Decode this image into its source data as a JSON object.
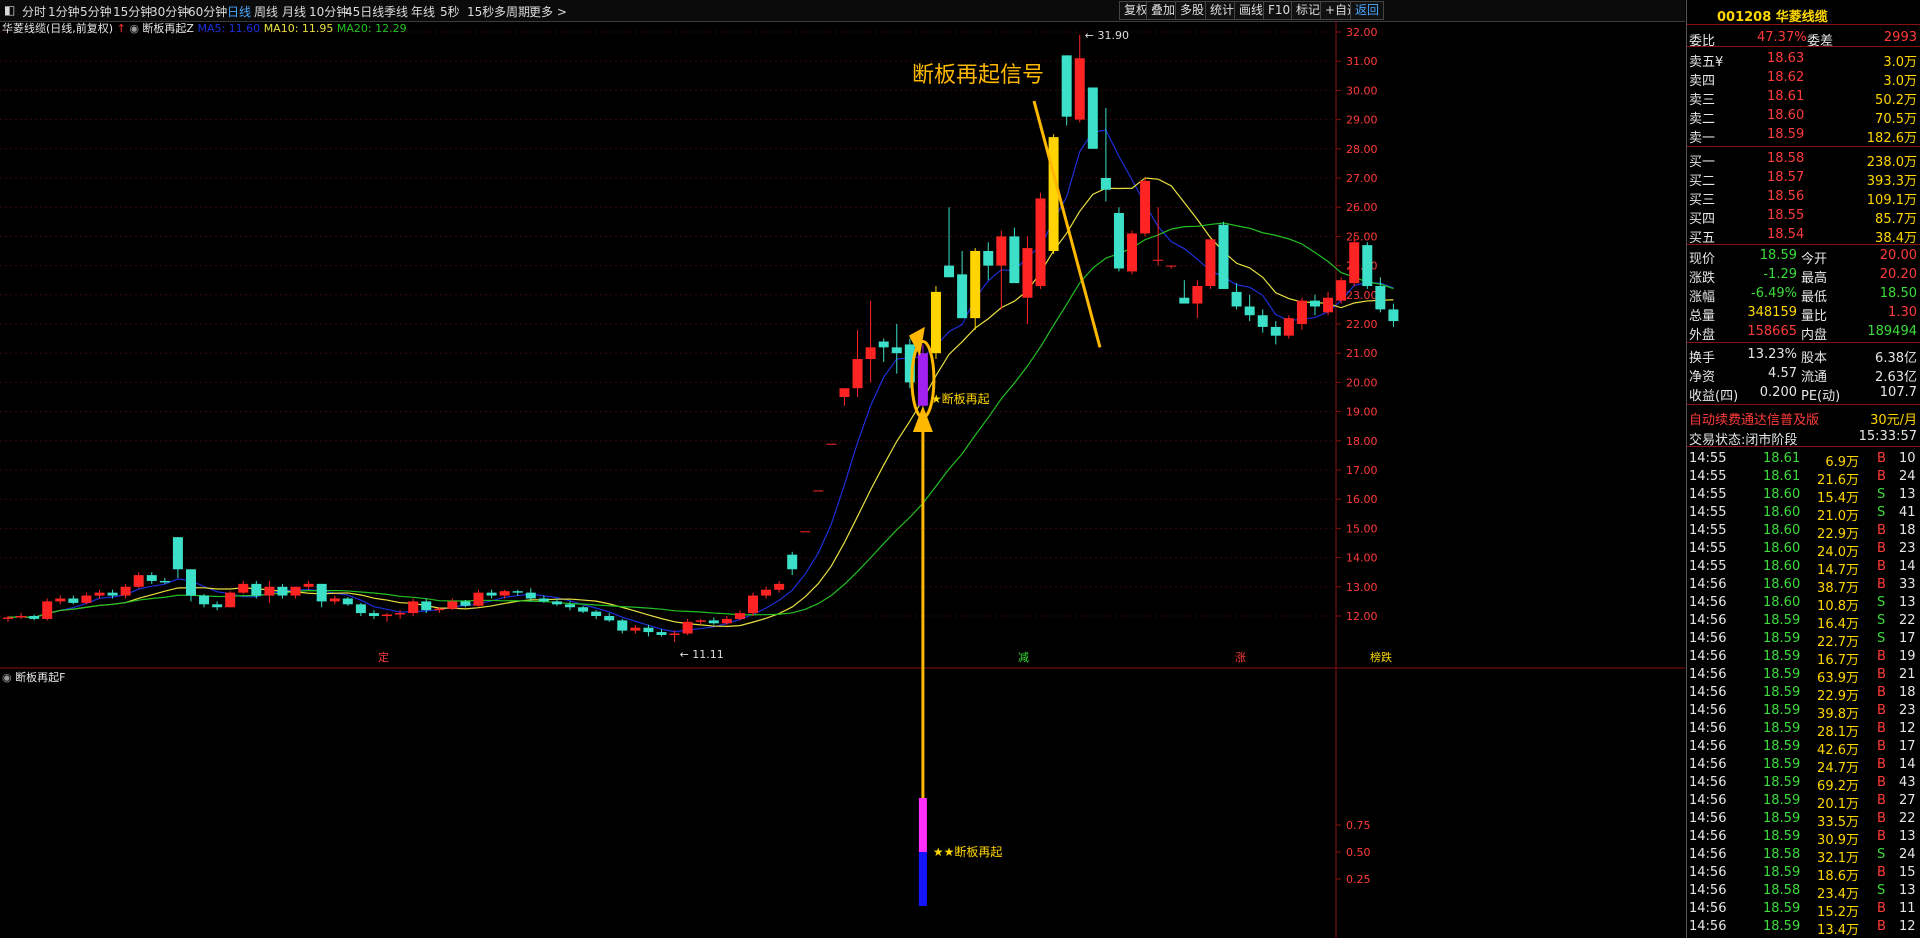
{
  "toolbar": {
    "periods": [
      "分时",
      "1分钟",
      "5分钟",
      "15分钟",
      "30分钟",
      "60分钟",
      "日线",
      "周线",
      "月线",
      "10分钟",
      "45日线",
      "季线",
      "年线",
      "5秒",
      "15秒",
      "多周期",
      "更多 >"
    ],
    "active": "日线",
    "right_buttons": [
      "复权",
      "叠加",
      "多股",
      "统计",
      "画线",
      "F10",
      "标记",
      "+自选",
      "返回"
    ],
    "selected_button": "返回"
  },
  "chart": {
    "stock_label": "华菱线缆(日线,前复权)",
    "indicator_name": "断板再起Z",
    "ma5": "MA5: 11.60",
    "ma10": "MA10: 11.95",
    "ma20": "MA20: 12.29",
    "high_label": "31.90",
    "low_label": "11.11",
    "annotation": "断板再起信号",
    "signal_label": "断板再起",
    "bottom_tags": [
      "定",
      "减",
      "涨",
      "榜跌"
    ],
    "yaxis": [
      "32.00",
      "31.00",
      "30.00",
      "29.00",
      "28.00",
      "27.00",
      "26.00",
      "25.00",
      "24.00",
      "23.00",
      "22.00",
      "21.00",
      "20.00",
      "19.00",
      "18.00",
      "17.00",
      "16.00",
      "15.00",
      "14.00",
      "13.00",
      "12.00"
    ],
    "sub_title": "断板再起F",
    "sub_yaxis": [
      "0.75",
      "0.50",
      "0.25"
    ],
    "sub_signal": "★断板再起",
    "colors": {
      "up": "#ff2424",
      "down": "#3ce0c8",
      "ma5": "#1d2fd8",
      "ma10": "#e8e040",
      "ma20": "#22c022",
      "signal": "#ffb800"
    }
  },
  "chart_data": {
    "type": "candlestick",
    "ylim": [
      11,
      32.2
    ],
    "candles": [
      [
        11.9,
        12.0,
        11.8,
        11.95
      ],
      [
        11.95,
        12.1,
        11.9,
        12.0
      ],
      [
        12.0,
        12.05,
        11.85,
        11.9
      ],
      [
        11.9,
        12.6,
        11.85,
        12.5
      ],
      [
        12.5,
        12.7,
        12.4,
        12.6
      ],
      [
        12.6,
        12.7,
        12.4,
        12.45
      ],
      [
        12.45,
        12.8,
        12.4,
        12.7
      ],
      [
        12.7,
        12.9,
        12.6,
        12.8
      ],
      [
        12.8,
        12.9,
        12.6,
        12.7
      ],
      [
        12.7,
        13.1,
        12.6,
        13.0
      ],
      [
        13.0,
        13.5,
        12.95,
        13.4
      ],
      [
        13.4,
        13.5,
        13.1,
        13.2
      ],
      [
        13.2,
        13.3,
        13.1,
        13.15
      ],
      [
        14.7,
        14.7,
        13.3,
        13.6
      ],
      [
        13.6,
        13.6,
        12.5,
        12.7
      ],
      [
        12.7,
        12.75,
        12.3,
        12.4
      ],
      [
        12.4,
        12.5,
        12.2,
        12.3
      ],
      [
        12.3,
        12.85,
        12.3,
        12.8
      ],
      [
        12.8,
        13.2,
        12.75,
        13.1
      ],
      [
        13.1,
        13.2,
        12.6,
        12.7
      ],
      [
        12.7,
        13.2,
        12.45,
        13.0
      ],
      [
        13.0,
        13.1,
        12.6,
        12.7
      ],
      [
        12.7,
        13.0,
        12.6,
        13.0
      ],
      [
        13.0,
        13.2,
        12.9,
        13.1
      ],
      [
        13.1,
        13.1,
        12.3,
        12.5
      ],
      [
        12.5,
        12.7,
        12.4,
        12.6
      ],
      [
        12.6,
        12.65,
        12.35,
        12.4
      ],
      [
        12.4,
        12.45,
        12.0,
        12.1
      ],
      [
        12.1,
        12.2,
        11.9,
        12.0
      ],
      [
        12.0,
        12.1,
        11.8,
        12.05
      ],
      [
        12.05,
        12.2,
        11.9,
        12.1
      ],
      [
        12.1,
        12.6,
        12.0,
        12.5
      ],
      [
        12.5,
        12.6,
        12.1,
        12.2
      ],
      [
        12.2,
        12.3,
        12.1,
        12.25
      ],
      [
        12.25,
        12.6,
        12.2,
        12.5
      ],
      [
        12.5,
        12.55,
        12.3,
        12.35
      ],
      [
        12.35,
        12.9,
        12.3,
        12.8
      ],
      [
        12.8,
        12.9,
        12.6,
        12.7
      ],
      [
        12.7,
        12.9,
        12.6,
        12.85
      ],
      [
        12.85,
        12.9,
        12.7,
        12.8
      ],
      [
        12.8,
        12.95,
        12.5,
        12.6
      ],
      [
        12.6,
        12.7,
        12.45,
        12.5
      ],
      [
        12.5,
        12.6,
        12.35,
        12.4
      ],
      [
        12.4,
        12.5,
        12.2,
        12.3
      ],
      [
        12.3,
        12.35,
        12.1,
        12.15
      ],
      [
        12.15,
        12.2,
        11.9,
        12.0
      ],
      [
        12.0,
        12.1,
        11.8,
        11.85
      ],
      [
        11.85,
        11.9,
        11.4,
        11.5
      ],
      [
        11.5,
        11.7,
        11.4,
        11.6
      ],
      [
        11.6,
        11.7,
        11.3,
        11.45
      ],
      [
        11.45,
        11.55,
        11.3,
        11.35
      ],
      [
        11.35,
        11.5,
        11.11,
        11.4
      ],
      [
        11.4,
        11.9,
        11.35,
        11.8
      ],
      [
        11.8,
        11.9,
        11.7,
        11.85
      ],
      [
        11.85,
        11.95,
        11.7,
        11.75
      ],
      [
        11.75,
        12.0,
        11.7,
        11.9
      ],
      [
        11.9,
        12.2,
        11.85,
        12.1
      ],
      [
        12.1,
        12.8,
        12.0,
        12.7
      ],
      [
        12.7,
        13.0,
        12.6,
        12.9
      ],
      [
        12.9,
        13.2,
        12.8,
        13.1
      ],
      [
        14.1,
        14.2,
        13.4,
        13.6
      ],
      [
        14.9,
        14.9,
        14.9,
        14.9
      ],
      [
        16.3,
        16.3,
        16.3,
        16.3
      ],
      [
        17.9,
        17.9,
        17.9,
        17.9
      ],
      [
        19.5,
        19.7,
        19.2,
        19.8
      ],
      [
        19.8,
        21.8,
        19.5,
        20.8
      ],
      [
        20.8,
        22.8,
        20.0,
        21.2
      ],
      [
        21.4,
        21.5,
        20.7,
        21.2
      ],
      [
        21.2,
        22.0,
        20.3,
        21.0
      ],
      [
        21.3,
        21.5,
        19.8,
        20.0
      ],
      [
        19.2,
        21.3,
        19.0,
        21.0
      ],
      [
        21.0,
        23.3,
        20.8,
        23.1
      ],
      [
        24.0,
        26.0,
        23.8,
        23.6
      ],
      [
        23.7,
        24.5,
        22.2,
        22.2
      ],
      [
        22.2,
        24.6,
        21.8,
        24.5
      ],
      [
        24.5,
        24.8,
        23.5,
        24.0
      ],
      [
        24.0,
        25.2,
        22.5,
        25.0
      ],
      [
        25.0,
        25.3,
        23.5,
        23.4
      ],
      [
        22.9,
        25.0,
        22.0,
        24.6
      ],
      [
        23.3,
        26.5,
        23.2,
        26.3
      ],
      [
        24.5,
        28.5,
        24.4,
        28.4
      ],
      [
        31.2,
        31.2,
        28.8,
        29.1
      ],
      [
        29.0,
        31.9,
        28.9,
        31.1
      ],
      [
        30.1,
        30.1,
        28.0,
        28.0
      ],
      [
        27.0,
        29.4,
        26.2,
        26.6
      ],
      [
        25.8,
        26.0,
        23.8,
        23.9
      ],
      [
        23.8,
        25.2,
        23.7,
        25.1
      ],
      [
        25.1,
        27.0,
        25.0,
        26.9
      ],
      [
        24.2,
        26.0,
        24.0,
        24.2
      ],
      [
        24.0,
        24.0,
        23.9,
        24.0
      ],
      [
        22.9,
        23.5,
        22.8,
        22.7
      ],
      [
        22.7,
        23.5,
        22.2,
        23.3
      ],
      [
        23.3,
        24.8,
        23.2,
        24.9
      ],
      [
        25.4,
        25.5,
        23.3,
        23.2
      ],
      [
        23.1,
        23.4,
        22.5,
        22.6
      ],
      [
        22.6,
        23.0,
        22.1,
        22.3
      ],
      [
        22.3,
        22.5,
        21.7,
        21.9
      ],
      [
        21.9,
        22.1,
        21.3,
        21.6
      ],
      [
        21.6,
        22.3,
        21.5,
        22.2
      ],
      [
        22.0,
        22.9,
        21.8,
        22.8
      ],
      [
        22.8,
        23.0,
        22.3,
        22.6
      ],
      [
        22.4,
        23.1,
        22.3,
        22.9
      ],
      [
        22.8,
        23.6,
        22.7,
        23.5
      ],
      [
        23.4,
        25.0,
        23.3,
        24.8
      ],
      [
        24.7,
        24.8,
        23.2,
        23.3
      ],
      [
        23.3,
        23.6,
        22.4,
        22.5
      ],
      [
        22.5,
        22.7,
        21.9,
        22.1
      ]
    ],
    "signal_index": 70
  },
  "panel": {
    "header": "001208 华菱线缆",
    "wb_label": "委比",
    "wb_val": "47.37%",
    "wc_label": "委差",
    "wc_val": "2993",
    "asks": [
      [
        "卖五¥",
        "18.63",
        "3.0万"
      ],
      [
        "卖四",
        "18.62",
        "3.0万"
      ],
      [
        "卖三",
        "18.61",
        "50.2万"
      ],
      [
        "卖二",
        "18.60",
        "70.5万"
      ],
      [
        "卖一",
        "18.59",
        "182.6万"
      ]
    ],
    "bids": [
      [
        "买一",
        "18.58",
        "238.0万"
      ],
      [
        "买二",
        "18.57",
        "393.3万"
      ],
      [
        "买三",
        "18.56",
        "109.1万"
      ],
      [
        "买四",
        "18.55",
        "85.7万"
      ],
      [
        "买五",
        "18.54",
        "38.4万"
      ]
    ],
    "quote": [
      [
        "现价",
        "18.59",
        "今开",
        "20.00"
      ],
      [
        "涨跌",
        "-1.29",
        "最高",
        "20.20"
      ],
      [
        "涨幅",
        "-6.49%",
        "最低",
        "18.50"
      ],
      [
        "总量",
        "348159",
        "量比",
        "1.30"
      ],
      [
        "外盘",
        "158665",
        "内盘",
        "189494"
      ]
    ],
    "quote2": [
      [
        "换手",
        "13.23%",
        "股本",
        "6.38亿"
      ],
      [
        "净资",
        "4.57",
        "流通",
        "2.63亿"
      ],
      [
        "收益(四)",
        "0.200",
        "PE(动)",
        "107.7"
      ]
    ],
    "ad": "自动续费通达信普及版",
    "ad_price": "30元/月",
    "status": "交易状态:闭市阶段",
    "status_time": "15:33:57",
    "ticks": [
      [
        "14:55",
        "18.61",
        "6.9万",
        "B",
        "10"
      ],
      [
        "14:55",
        "18.61",
        "21.6万",
        "B",
        "24"
      ],
      [
        "14:55",
        "18.60",
        "15.4万",
        "S",
        "13"
      ],
      [
        "14:55",
        "18.60",
        "21.0万",
        "S",
        "41"
      ],
      [
        "14:55",
        "18.60",
        "22.9万",
        "B",
        "18"
      ],
      [
        "14:55",
        "18.60",
        "24.0万",
        "B",
        "23"
      ],
      [
        "14:55",
        "18.60",
        "14.7万",
        "B",
        "14"
      ],
      [
        "14:56",
        "18.60",
        "38.7万",
        "B",
        "33"
      ],
      [
        "14:56",
        "18.60",
        "10.8万",
        "S",
        "13"
      ],
      [
        "14:56",
        "18.59",
        "16.4万",
        "S",
        "22"
      ],
      [
        "14:56",
        "18.59",
        "22.7万",
        "S",
        "17"
      ],
      [
        "14:56",
        "18.59",
        "16.7万",
        "B",
        "19"
      ],
      [
        "14:56",
        "18.59",
        "63.9万",
        "B",
        "21"
      ],
      [
        "14:56",
        "18.59",
        "22.9万",
        "B",
        "18"
      ],
      [
        "14:56",
        "18.59",
        "39.8万",
        "B",
        "23"
      ],
      [
        "14:56",
        "18.59",
        "28.1万",
        "B",
        "12"
      ],
      [
        "14:56",
        "18.59",
        "42.6万",
        "B",
        "17"
      ],
      [
        "14:56",
        "18.59",
        "24.7万",
        "B",
        "14"
      ],
      [
        "14:56",
        "18.59",
        "69.2万",
        "B",
        "43"
      ],
      [
        "14:56",
        "18.59",
        "20.1万",
        "B",
        "27"
      ],
      [
        "14:56",
        "18.59",
        "33.5万",
        "B",
        "22"
      ],
      [
        "14:56",
        "18.59",
        "30.9万",
        "B",
        "13"
      ],
      [
        "14:56",
        "18.58",
        "32.1万",
        "S",
        "24"
      ],
      [
        "14:56",
        "18.59",
        "18.6万",
        "B",
        "15"
      ],
      [
        "14:56",
        "18.58",
        "23.4万",
        "S",
        "13"
      ],
      [
        "14:56",
        "18.59",
        "15.2万",
        "B",
        "11"
      ],
      [
        "14:56",
        "18.59",
        "13.4万",
        "B",
        "12"
      ]
    ]
  }
}
